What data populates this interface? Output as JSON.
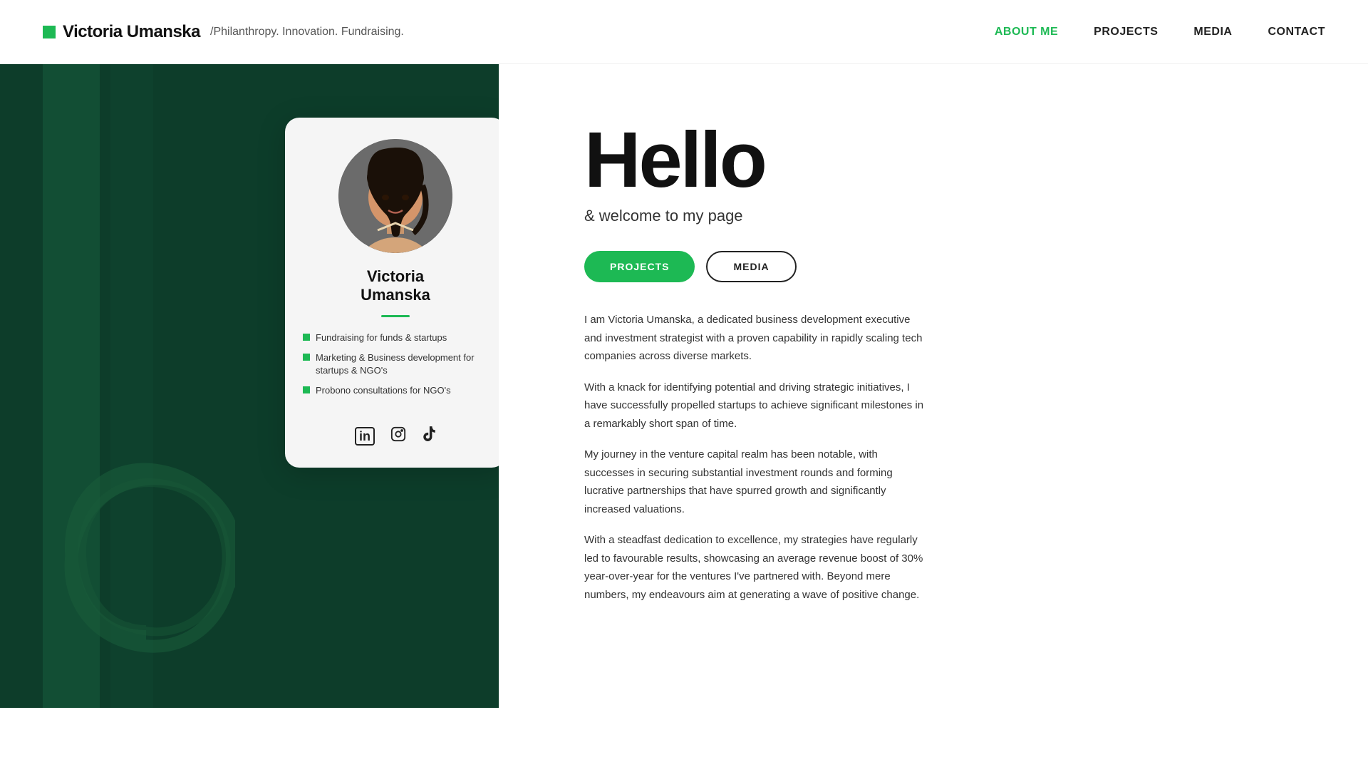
{
  "header": {
    "logo_square_color": "#1db954",
    "logo_name": "Victoria Umanska",
    "logo_tagline": "/Philanthropy. Innovation. Fundraising.",
    "nav": [
      {
        "label": "ABOUT ME",
        "active": true,
        "id": "about-me"
      },
      {
        "label": "PROJECTS",
        "active": false,
        "id": "projects"
      },
      {
        "label": "MEDIA",
        "active": false,
        "id": "media"
      },
      {
        "label": "CONTACT",
        "active": false,
        "id": "contact"
      }
    ]
  },
  "profile_card": {
    "name_line1": "Victoria",
    "name_line2": "Umanska",
    "skills": [
      "Fundraising for funds & startups",
      "Marketing & Business development for startups & NGO's",
      "Probono consultations for NGO's"
    ],
    "social": [
      {
        "name": "linkedin",
        "icon": "in"
      },
      {
        "name": "instagram",
        "icon": "⊙"
      },
      {
        "name": "tiktok",
        "icon": "♪"
      }
    ]
  },
  "hero": {
    "title": "Hello",
    "subtitle": "& welcome to my page",
    "btn_projects": "PROJECTS",
    "btn_media": "MEDIA",
    "bio_paragraphs": [
      "I am Victoria Umanska, a dedicated business development executive and investment strategist with a proven capability in rapidly scaling tech companies across diverse markets.",
      "With a knack for identifying potential and driving strategic initiatives, I have successfully propelled startups to achieve significant milestones in a remarkably short span of time.",
      "My journey in the venture capital realm has been notable, with successes in securing substantial investment rounds and forming lucrative partnerships that have spurred growth and significantly increased valuations.",
      "With a steadfast dedication to excellence, my strategies have regularly led to favourable results, showcasing an average revenue boost of 30% year-over-year for the ventures I've partnered with. Beyond mere numbers, my endeavours aim at generating a wave of positive change."
    ]
  }
}
